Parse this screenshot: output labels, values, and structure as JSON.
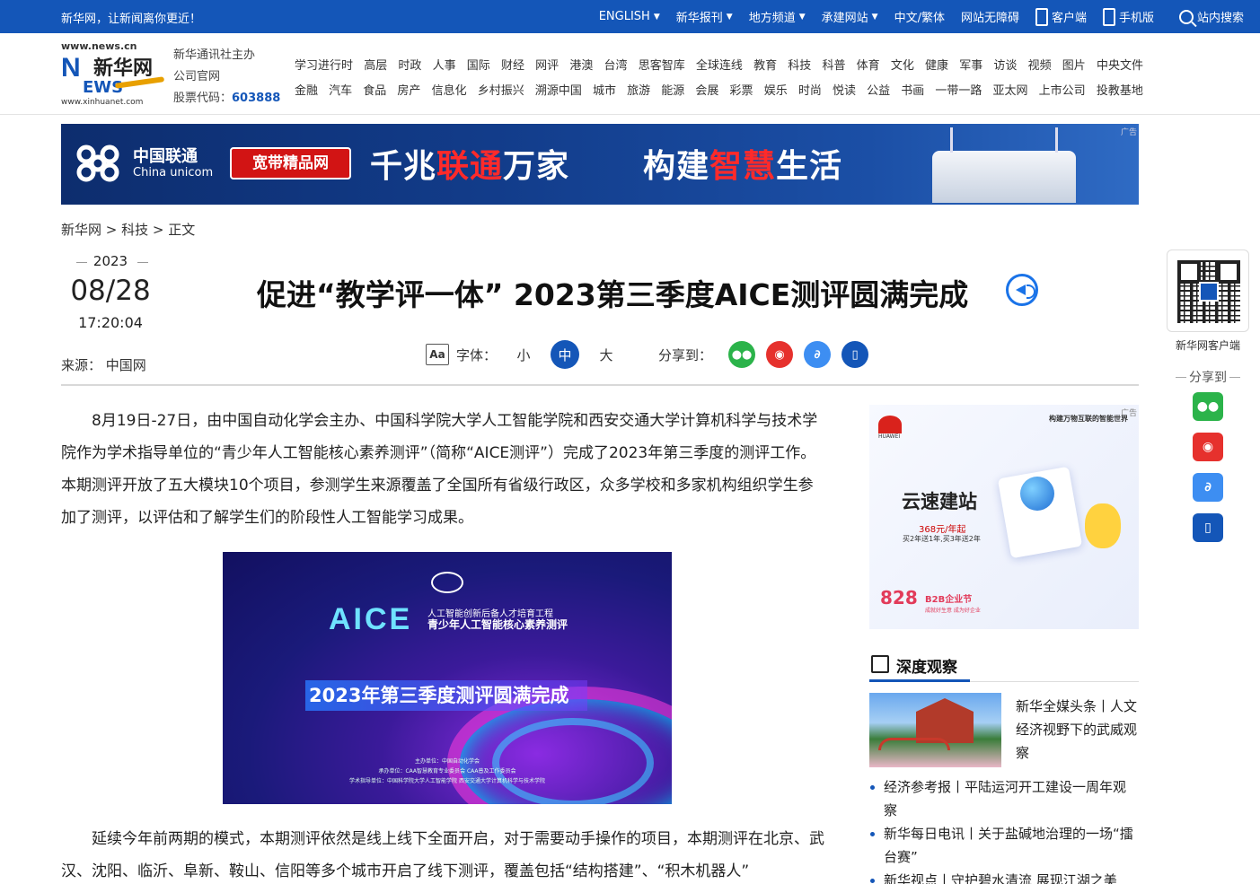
{
  "topbar": {
    "slogan": "新华网，让新闻离你更近！",
    "nav": [
      {
        "label": "ENGLISH",
        "caret": true
      },
      {
        "label": "新华报刊",
        "caret": true
      },
      {
        "label": "地方频道",
        "caret": true
      },
      {
        "label": "承建网站",
        "caret": true
      },
      {
        "label": "中文/繁体",
        "caret": false
      },
      {
        "label": "网站无障碍",
        "caret": false
      }
    ],
    "client_label": "客户端",
    "mobile_label": "手机版",
    "search_label": "站内搜索",
    "color": "#1456b8"
  },
  "logo": {
    "url_top": "www.news.cn",
    "brand_cn": "新华网",
    "brand_n": "N",
    "brand_ews": "EWS",
    "url_bottom": "www.xinhuanet.com"
  },
  "org": {
    "line1": "新华通讯社主办",
    "line2": "公司官网",
    "stock_label": "股票代码：",
    "stock_code": "603888"
  },
  "mainnav": {
    "row1": [
      "学习进行时",
      "高层",
      "时政",
      "人事",
      "国际",
      "财经",
      "网评",
      "港澳",
      "台湾",
      "思客智库",
      "全球连线",
      "教育",
      "科技",
      "科普",
      "体育",
      "文化",
      "健康",
      "军事",
      "访谈",
      "视频",
      "图片",
      "中央文件"
    ],
    "row2": [
      "金融",
      "汽车",
      "食品",
      "房产",
      "信息化",
      "乡村振兴",
      "溯源中国",
      "城市",
      "旅游",
      "能源",
      "会展",
      "彩票",
      "娱乐",
      "时尚",
      "悦读",
      "公益",
      "书画",
      "一带一路",
      "亚太网",
      "上市公司",
      "投教基地"
    ]
  },
  "banner": {
    "ad_label": "广告",
    "brand_cn": "中国联通",
    "brand_en": "China unicom",
    "tag": "宽带精品网",
    "slogan1_a": "千兆",
    "slogan1_b": "联通",
    "slogan1_c": "万家",
    "slogan2_a": "构建",
    "slogan2_b": "智慧",
    "slogan2_c": "生活",
    "accent": "#ff2a2a"
  },
  "breadcrumb": "新华网 > 科技 > 正文",
  "article": {
    "year": "2023",
    "month_day": "08/28",
    "time": "17:20:04",
    "source": "来源：  中国网",
    "title": "促进“教学评一体” 2023第三季度AICE测评圆满完成",
    "audio_icon": "speaker-icon",
    "font_label": "字体：",
    "font_sizes": [
      "小",
      "中",
      "大"
    ],
    "font_active": "中",
    "share_label": "分享到：",
    "para1": "8月19日-27日，由中国自动化学会主办、中国科学院大学人工智能学院和西安交通大学计算机科学与技术学院作为学术指导单位的“青少年人工智能核心素养测评”（简称“AICE测评”）完成了2023年第三季度的测评工作。本期测评开放了五大模块10个项目，参测学生来源覆盖了全国所有省级行政区，众多学校和多家机构组织学生参加了测评，以评估和了解学生们的阶段性人工智能学习成果。",
    "para2": "延续今年前两期的模式，本期测评依然是线上线下全面开启，对于需要动手操作的项目，本期测评在北京、武汉、沈阳、临沂、阜新、鞍山、信阳等多个城市开启了线下测评，覆盖包括“结构搭建”、“积木机器人”"
  },
  "figure": {
    "aice": "AICE",
    "sub1": "人工智能创新后备人才培育工程",
    "sub2": "青少年人工智能核心素养测评",
    "headline": "2023年第三季度测评圆满完成",
    "credit1": "主办单位：中国自动化学会",
    "credit2": "承办单位：CAA智慧教育专业委员会  CAA普及工作委员会",
    "credit3": "学术指导单位：中国科学院大学人工智能学院  西安交通大学计算机科学与技术学院"
  },
  "sidead": {
    "ad_label": "广告",
    "brand": "HUAWEI",
    "tagline": "构建万物互联的智能世界",
    "headline": "云速建站",
    "price": "368元/年起",
    "gift": "买2年送1年,买3年送2年",
    "event": "828",
    "event_name": "B2B企业节",
    "event_sub": "成就好生意 成为好企业"
  },
  "deep": {
    "title": "深度观察",
    "feature_text": "新华全媒头条丨人文经济视野下的武威观察",
    "items": [
      "经济参考报丨平陆运河开工建设一周年观察",
      "新华每日电讯丨关于盐碱地治理的一场“擂台赛”",
      "新华视点丨守护碧水清流 展现江湖之美"
    ]
  },
  "rail": {
    "qr_label": "新华网客户端",
    "share_label": "分享到"
  }
}
